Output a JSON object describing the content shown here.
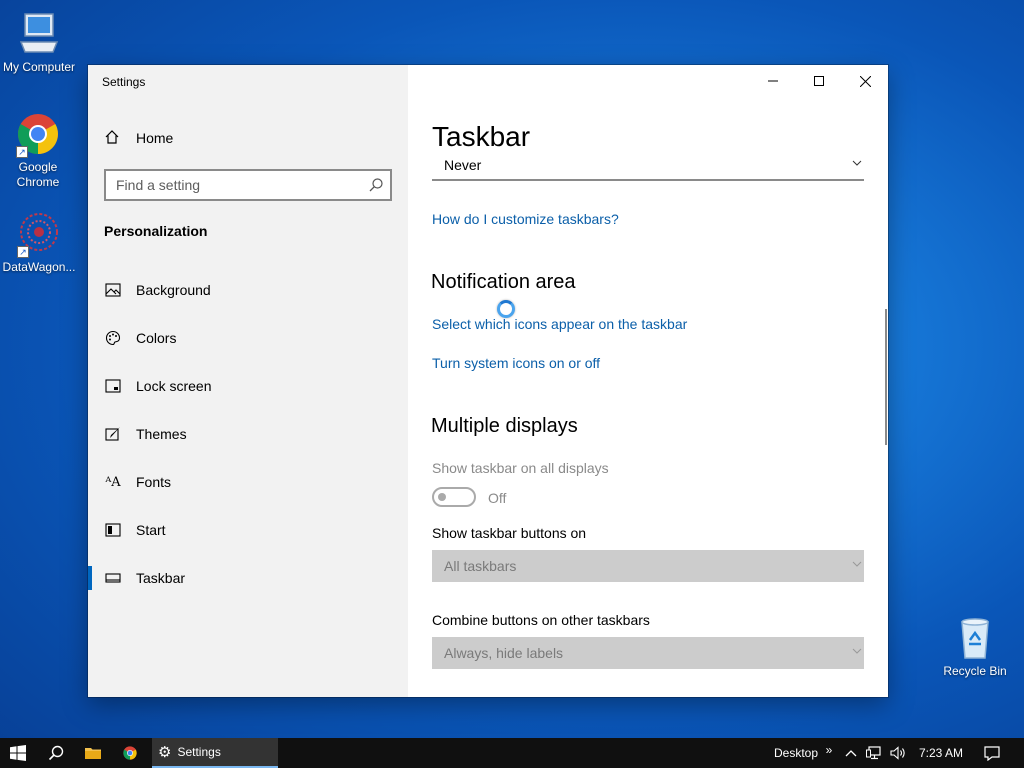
{
  "desktop": {
    "icons": [
      {
        "label": "My Computer"
      },
      {
        "label": "Google Chrome"
      },
      {
        "label": "DataWagon..."
      },
      {
        "label": "Recycle Bin"
      }
    ]
  },
  "window": {
    "title": "Settings",
    "controls": {
      "minimize_icon": "minimize-icon",
      "maximize_icon": "maximize-icon",
      "close_icon": "close-icon"
    }
  },
  "sidebar": {
    "home_label": "Home",
    "search_placeholder": "Find a setting",
    "section_title": "Personalization",
    "items": [
      {
        "label": "Background",
        "icon": "picture-icon"
      },
      {
        "label": "Colors",
        "icon": "palette-icon"
      },
      {
        "label": "Lock screen",
        "icon": "lock-screen-icon"
      },
      {
        "label": "Themes",
        "icon": "brush-icon"
      },
      {
        "label": "Fonts",
        "icon": "font-icon"
      },
      {
        "label": "Start",
        "icon": "start-icon"
      },
      {
        "label": "Taskbar",
        "icon": "taskbar-icon",
        "active": true
      }
    ]
  },
  "content": {
    "title": "Taskbar",
    "combine_value": "Never",
    "customize_link": "How do I customize taskbars?",
    "notification_heading": "Notification area",
    "notification_links": [
      "Select which icons appear on the taskbar",
      "Turn system icons on or off"
    ],
    "multiple_displays_heading": "Multiple displays",
    "show_all_label": "Show taskbar on all displays",
    "show_all_state": "Off",
    "buttons_on_label": "Show taskbar buttons on",
    "buttons_on_value": "All taskbars",
    "combine_other_label": "Combine buttons on other taskbars",
    "combine_other_value": "Always, hide labels"
  },
  "taskbar": {
    "active_app": "Settings",
    "desktop_label": "Desktop",
    "overflow": "»",
    "time": "7:23 AM"
  },
  "colors": {
    "accent": "#0067c0",
    "link": "#0b5fa9",
    "taskbar": "#101010"
  }
}
